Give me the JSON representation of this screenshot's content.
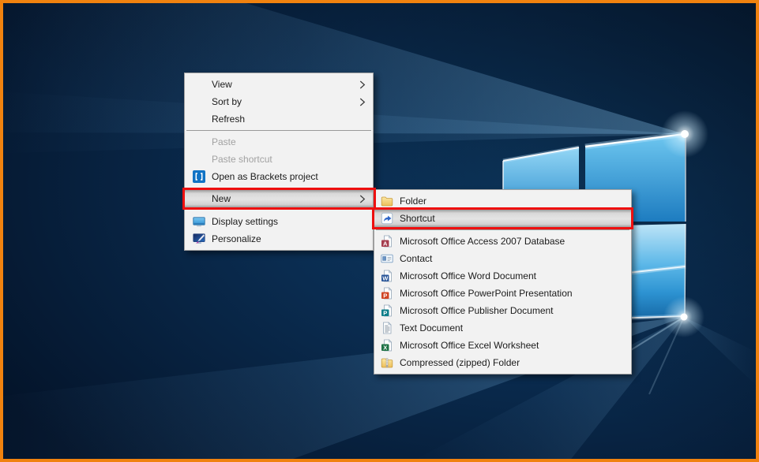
{
  "window": {
    "description": "Windows 10 desktop right-click context menu with New submenu open",
    "frame_border_color": "#f0820f"
  },
  "wallpaper": {
    "name": "windows-10-hero",
    "base_color": "#0a2c50",
    "logo_light_color": "#ffffff",
    "pane_top_color": "#6ec7f0",
    "pane_bottom_color": "#1d7cc0"
  },
  "context_menu": {
    "items": [
      {
        "label": "View",
        "has_submenu": true
      },
      {
        "label": "Sort by",
        "has_submenu": true
      },
      {
        "label": "Refresh"
      },
      {
        "label": "Paste",
        "disabled": true
      },
      {
        "label": "Paste shortcut",
        "disabled": true
      },
      {
        "label": "Open as Brackets project",
        "icon": "brackets-icon"
      },
      {
        "label": "New",
        "has_submenu": true,
        "highlighted": true
      },
      {
        "label": "Display settings",
        "icon": "display-icon"
      },
      {
        "label": "Personalize",
        "icon": "personalize-icon"
      }
    ]
  },
  "submenu": {
    "items": [
      {
        "label": "Folder",
        "icon": "folder-icon"
      },
      {
        "label": "Shortcut",
        "icon": "shortcut-icon",
        "highlighted": true
      },
      {
        "label": "Microsoft Office Access 2007 Database",
        "icon": "access-icon"
      },
      {
        "label": "Contact",
        "icon": "contact-icon"
      },
      {
        "label": "Microsoft Office Word Document",
        "icon": "word-icon"
      },
      {
        "label": "Microsoft Office PowerPoint Presentation",
        "icon": "powerpoint-icon"
      },
      {
        "label": "Microsoft Office Publisher Document",
        "icon": "publisher-icon"
      },
      {
        "label": "Text Document",
        "icon": "text-document-icon"
      },
      {
        "label": "Microsoft Office Excel Worksheet",
        "icon": "excel-icon"
      },
      {
        "label": "Compressed (zipped) Folder",
        "icon": "zip-folder-icon"
      }
    ]
  },
  "annotations": {
    "highlight_color": "#ee0f0f",
    "highlighted_items": [
      "New",
      "Shortcut"
    ]
  },
  "icons": {
    "access_badge": "A",
    "word_badge": "W",
    "powerpoint_badge": "P",
    "publisher_badge": "P",
    "excel_badge": "X"
  },
  "colors": {
    "menu_background": "#f2f2f2",
    "menu_border": "#a3a3a3",
    "menu_text": "#1b1b1b",
    "disabled_text": "#a2a2a2",
    "hover_row": "#d8d8d8",
    "separator": "#9a9a9a"
  }
}
